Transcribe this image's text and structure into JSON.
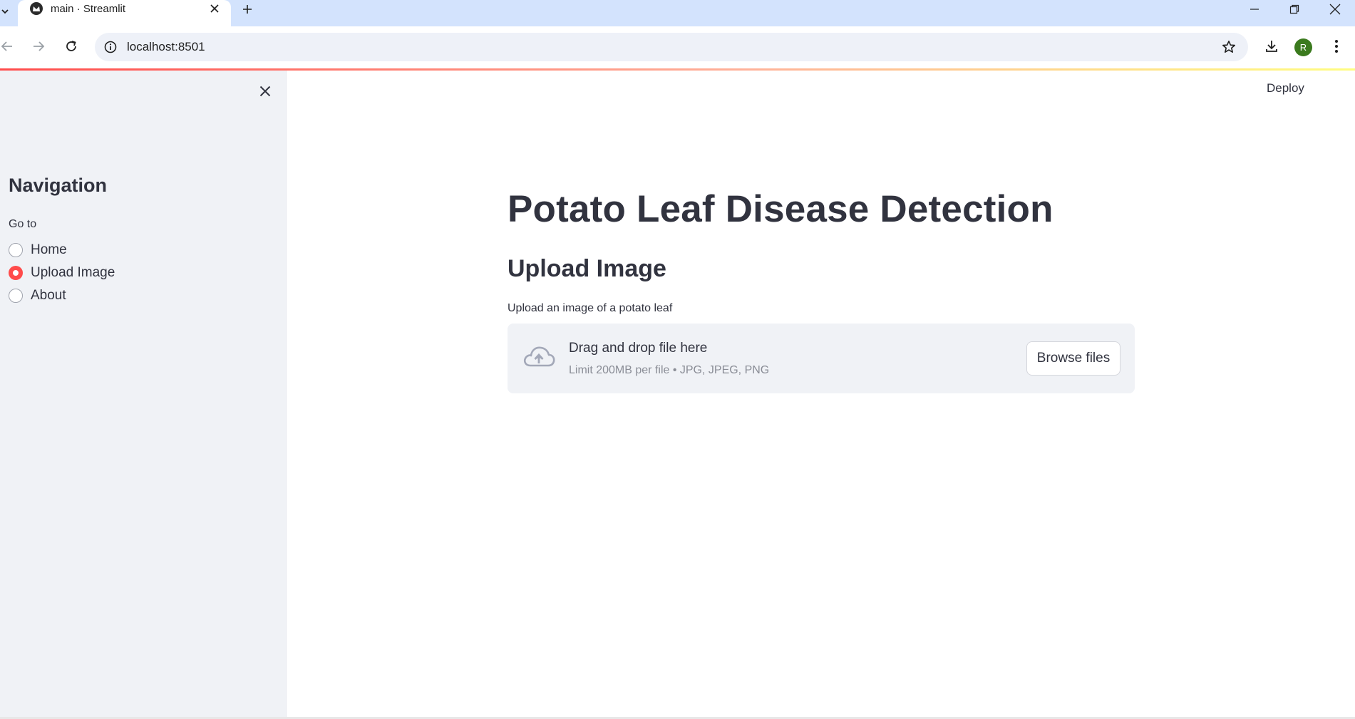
{
  "browser": {
    "tab_title": "main · Streamlit",
    "url": "localhost:8501",
    "profile_initial": "R"
  },
  "sidebar": {
    "heading": "Navigation",
    "radio_group_label": "Go to",
    "options": [
      {
        "label": "Home",
        "selected": false
      },
      {
        "label": "Upload Image",
        "selected": true
      },
      {
        "label": "About",
        "selected": false
      }
    ]
  },
  "header": {
    "deploy_label": "Deploy"
  },
  "main": {
    "title": "Potato Leaf Disease Detection",
    "section_title": "Upload Image",
    "uploader": {
      "label": "Upload an image of a potato leaf",
      "drop_text": "Drag and drop file here",
      "limit_text": "Limit 200MB per file • JPG, JPEG, PNG",
      "browse_label": "Browse files"
    }
  },
  "colors": {
    "accent": "#ff4b4b",
    "sidebar_bg": "#f0f2f6",
    "text": "#31333f",
    "tabstrip_bg": "#d3e3fd"
  },
  "icons": [
    "tab-search-icon",
    "streamlit-favicon",
    "close-icon",
    "plus-icon",
    "minimize-icon",
    "restore-icon",
    "back-icon",
    "forward-icon",
    "reload-icon",
    "info-icon",
    "star-icon",
    "download-icon",
    "more-icon",
    "cloud-upload-icon"
  ]
}
